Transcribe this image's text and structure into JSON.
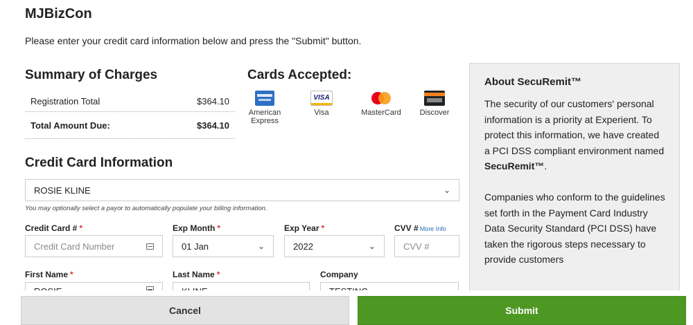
{
  "header": {
    "brand": "MJBizCon",
    "intro": "Please enter your credit card information below and press the \"Submit\" button."
  },
  "summary": {
    "title": "Summary of Charges",
    "rows": [
      {
        "label": "Registration Total",
        "amount": "$364.10"
      },
      {
        "label": "Total Amount Due:",
        "amount": "$364.10"
      }
    ]
  },
  "cards_accepted": {
    "title": "Cards Accepted:",
    "cards": [
      {
        "name": "American Express",
        "icon": "amex-logo-icon",
        "line1": "American",
        "line2": "Express"
      },
      {
        "name": "Visa",
        "icon": "visa-logo-icon",
        "line1": "Visa"
      },
      {
        "name": "MasterCard",
        "icon": "mastercard-logo-icon",
        "line1": "MasterCard"
      },
      {
        "name": "Discover",
        "icon": "discover-logo-icon",
        "line1": "Discover"
      }
    ]
  },
  "credit_card": {
    "title": "Credit Card Information",
    "payor_value": "ROSIE KLINE",
    "payor_help": "You may optionally select a payor to automatically populate your billing information.",
    "fields": {
      "card_number": {
        "label": "Credit Card #",
        "placeholder": "Credit Card Number"
      },
      "exp_month": {
        "label": "Exp Month",
        "value": "01 Jan"
      },
      "exp_year": {
        "label": "Exp Year",
        "value": "2022"
      },
      "cvv": {
        "label": "CVV #",
        "placeholder": "CVV #",
        "more_info": "More Info"
      },
      "first_name": {
        "label": "First Name",
        "value": "ROSIE"
      },
      "last_name": {
        "label": "Last Name",
        "value": "KLINE"
      },
      "company": {
        "label": "Company",
        "value": "TESTING"
      }
    },
    "required_mark": "*"
  },
  "sidebar": {
    "title": "About SecuRemit™",
    "p1": "The security of our customers' personal information is a priority at Experient. To protect this information, we have created a PCI DSS compliant environment named ",
    "p1_bold": "SecuRemit™",
    "p1_end": ".",
    "p2": "Companies who conform to the guidelines set forth in the Payment Card Industry Data Security Standard (PCI DSS) have taken the rigorous steps necessary to provide customers"
  },
  "footer": {
    "cancel_label": "Cancel",
    "submit_label": "Submit"
  },
  "colors": {
    "submit_green": "#4d9823",
    "required_red": "#e0303a",
    "link_blue": "#2a6ebb",
    "sidebar_bg": "#efefef"
  }
}
